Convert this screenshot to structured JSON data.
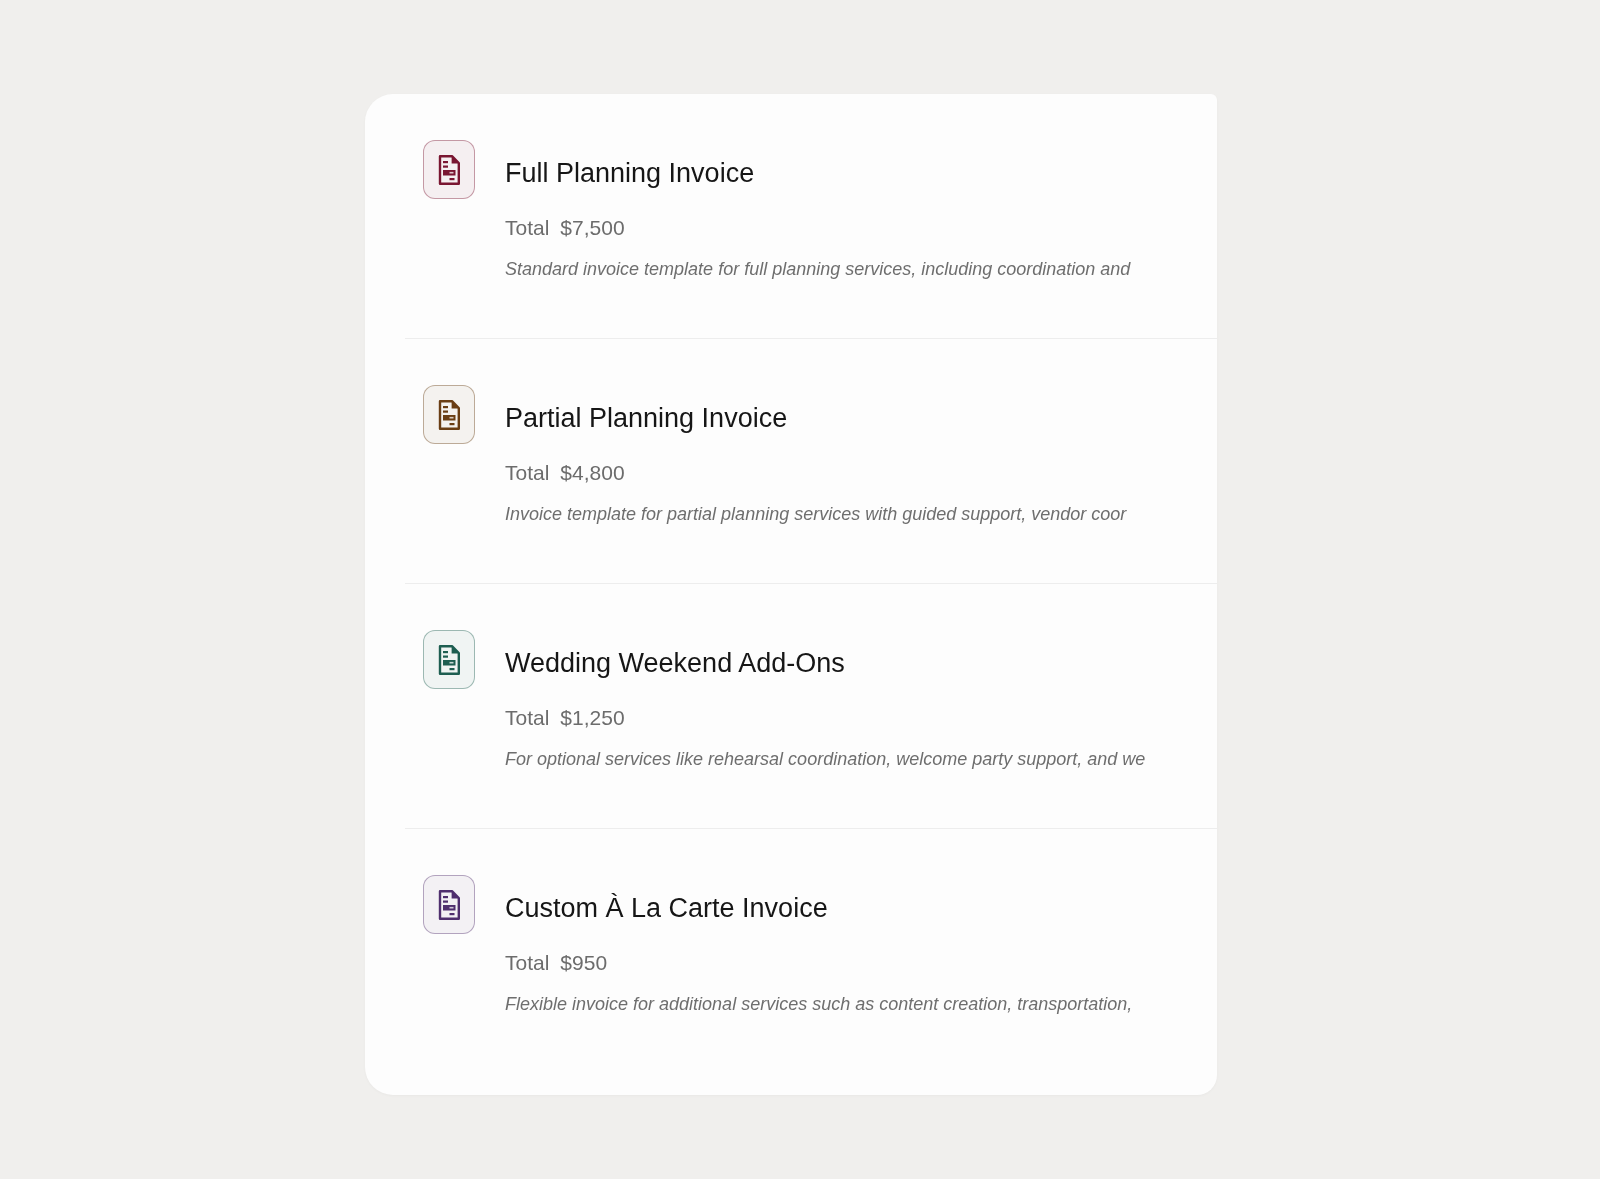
{
  "invoices": [
    {
      "title": "Full Planning Invoice",
      "total_label": "Total",
      "total": "$7,500",
      "description": "Standard invoice template for full planning services, including coordination and",
      "color": "#7a1632"
    },
    {
      "title": "Partial Planning Invoice",
      "total_label": "Total",
      "total": "$4,800",
      "description": "Invoice template for partial planning services with guided support, vendor coor",
      "color": "#6a3e14"
    },
    {
      "title": "Wedding Weekend Add-Ons",
      "total_label": "Total",
      "total": "$1,250",
      "description": "For optional services like rehearsal coordination, welcome party support, and we",
      "color": "#1e5e51"
    },
    {
      "title": "Custom À La Carte Invoice",
      "total_label": "Total",
      "total": "$950",
      "description": "Flexible invoice for additional services such as content creation, transportation,",
      "color": "#4f2f6e"
    }
  ]
}
